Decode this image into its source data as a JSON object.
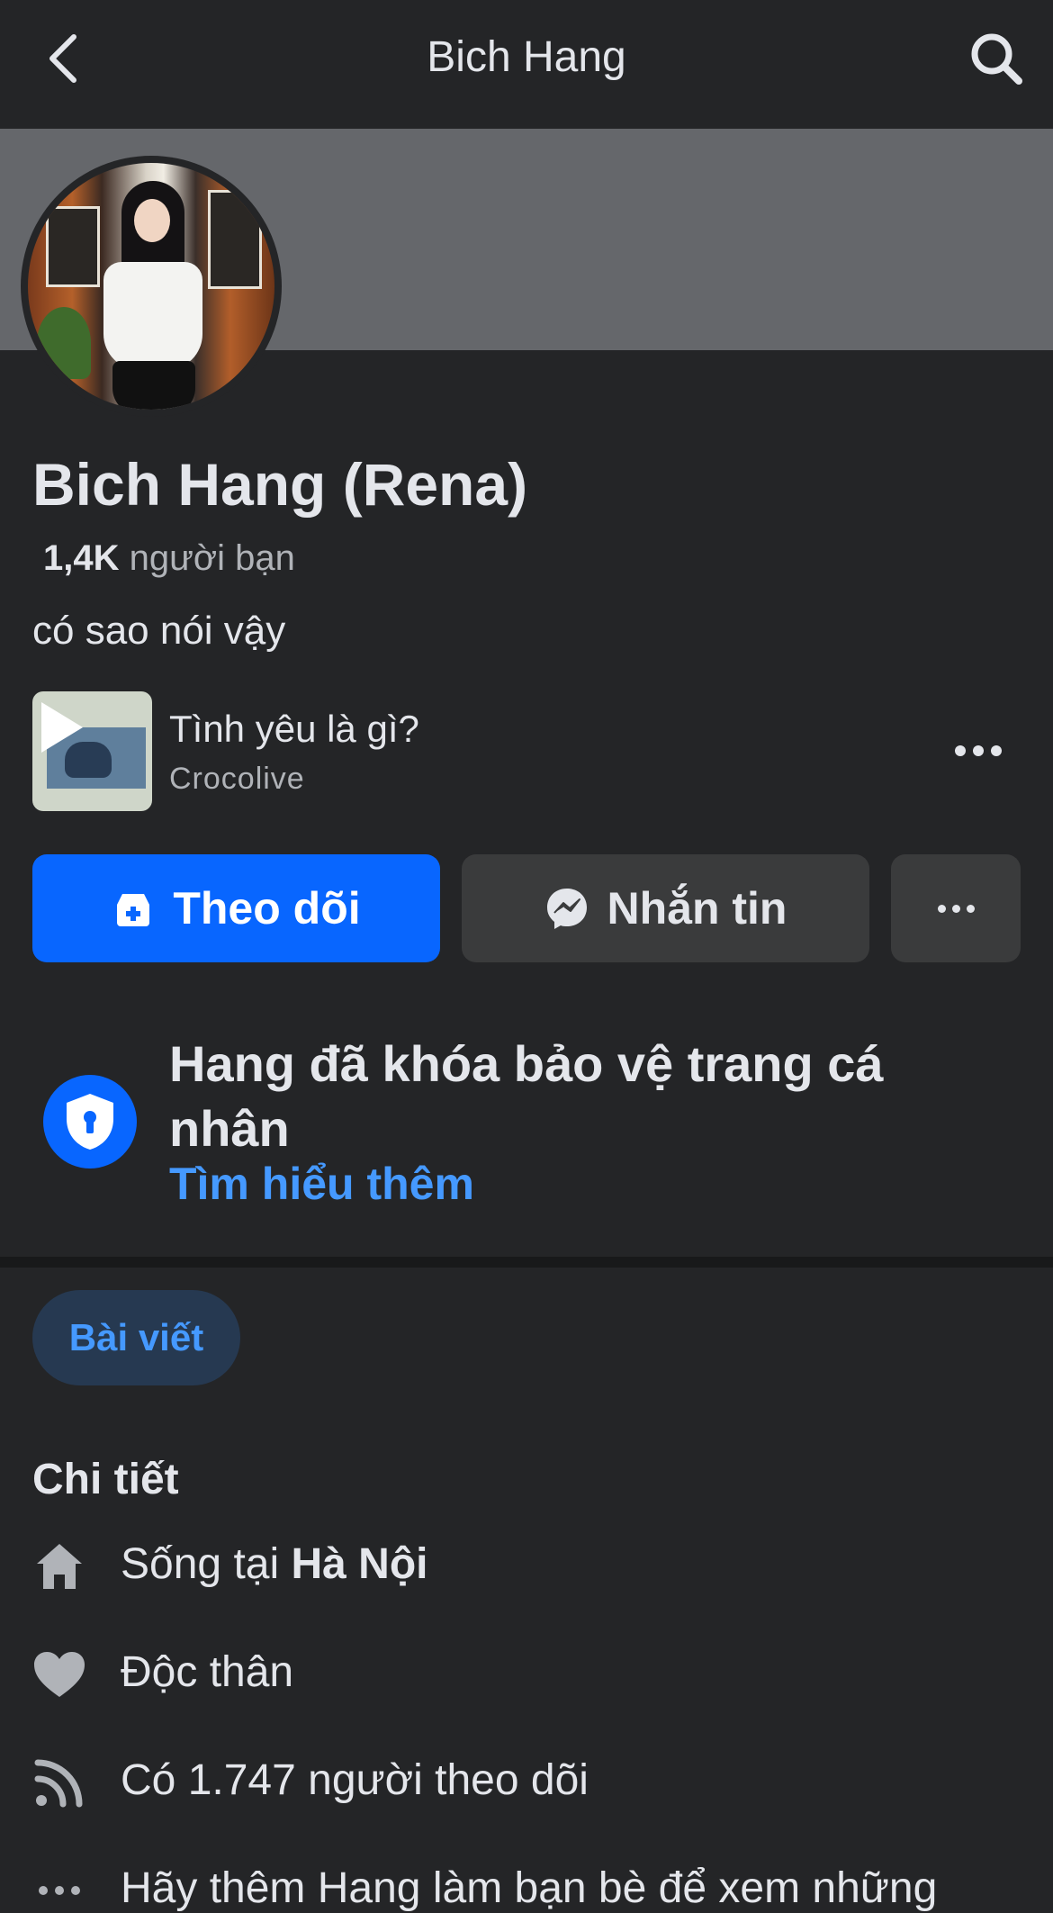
{
  "header": {
    "title": "Bich Hang"
  },
  "profile": {
    "name": "Bich Hang (Rena)",
    "friends_count": "1,4K",
    "friends_label": "người bạn",
    "bio": "có sao nói vậy"
  },
  "music": {
    "title": "Tình yêu là gì?",
    "artist": "Crocolive"
  },
  "actions": {
    "follow_label": "Theo dõi",
    "message_label": "Nhắn tin"
  },
  "lock_notice": {
    "title": "Hang đã khóa bảo vệ trang cá nhân",
    "link": "Tìm hiểu thêm"
  },
  "tabs": [
    {
      "label": "Bài viết",
      "active": true
    }
  ],
  "details": {
    "title": "Chi tiết",
    "items": [
      {
        "icon": "home-icon",
        "prefix": "Sống tại ",
        "strong": "Hà Nội"
      },
      {
        "icon": "heart-icon",
        "prefix": "Độc thân",
        "strong": ""
      },
      {
        "icon": "feed-icon",
        "prefix": "Có 1.747 người theo dõi",
        "strong": ""
      },
      {
        "icon": "more-dots-icon",
        "prefix": "Hãy thêm Hang làm bạn bè để xem những",
        "strong": ""
      }
    ]
  },
  "colors": {
    "background": "#242527",
    "cover": "#65676b",
    "primary": "#0866ff",
    "link": "#4599ff",
    "secondary_button": "#3a3b3c",
    "tab_active_bg": "#263951"
  }
}
